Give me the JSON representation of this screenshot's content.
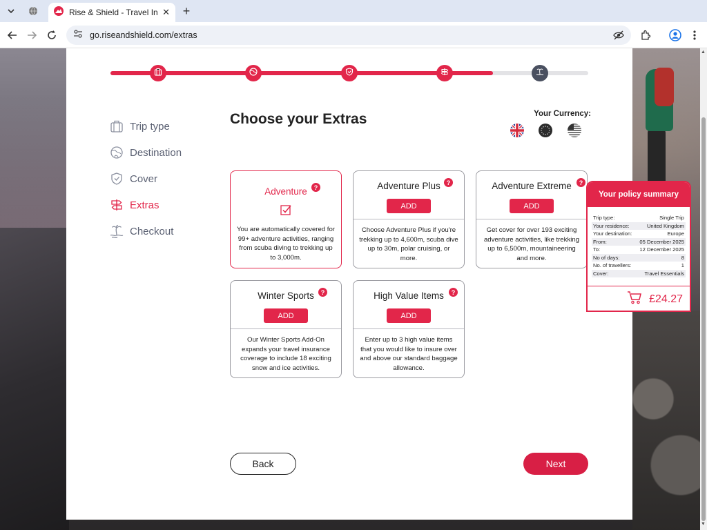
{
  "browser": {
    "tab_title": "Rise & Shield - Travel Insurance",
    "tab_close": "✕",
    "new_tab": "+",
    "url": "go.riseandshield.com/extras"
  },
  "nav": {
    "items": [
      {
        "label": "Trip type",
        "icon": "luggage-icon"
      },
      {
        "label": "Destination",
        "icon": "globe-icon"
      },
      {
        "label": "Cover",
        "icon": "shield-heart-icon"
      },
      {
        "label": "Extras",
        "icon": "signpost-icon"
      },
      {
        "label": "Checkout",
        "icon": "beach-icon"
      }
    ],
    "active": "Extras"
  },
  "progress": {
    "completed_steps": 4,
    "total_steps": 5,
    "fill_fraction": 0.8
  },
  "page": {
    "title": "Choose your Extras"
  },
  "currency": {
    "label": "Your Currency:",
    "options": [
      "GBP",
      "EUR",
      "USD"
    ],
    "selected": "GBP"
  },
  "extras": [
    {
      "title": "Adventure",
      "state": "included",
      "desc": "You are automatically covered for 99+ adventure activities, ranging from scuba diving to trekking up to 3,000m."
    },
    {
      "title": "Adventure Plus",
      "state": "available",
      "button": "ADD",
      "desc": "Choose Adventure Plus if you're trekking up to 4,600m, scuba dive up to 30m, polar cruising, or more."
    },
    {
      "title": "Adventure Extreme",
      "state": "available",
      "button": "ADD",
      "desc": "Get cover for over 193 exciting adventure activities, like trekking up to 6,500m, mountaineering and more."
    },
    {
      "title": "Winter Sports",
      "state": "available",
      "button": "ADD",
      "desc": "Our Winter Sports Add-On expands your travel insurance coverage to include 18 exciting snow and ice activities."
    },
    {
      "title": "High Value Items",
      "state": "available",
      "button": "ADD",
      "desc": "Enter up to 3 high value items that you would like to insure over and above our standard baggage allowance."
    }
  ],
  "help_glyph": "?",
  "buttons": {
    "back": "Back",
    "next": "Next"
  },
  "summary": {
    "title": "Your policy summary",
    "rows": [
      {
        "label": "Trip type:",
        "value": "Single Trip"
      },
      {
        "label": "Your residence:",
        "value": "United Kingdom"
      },
      {
        "label": "Your destination:",
        "value": "Europe"
      },
      {
        "label": "From:",
        "value": "05 December 2025"
      },
      {
        "label": "To:",
        "value": "12 December 2025"
      },
      {
        "label": "No of days:",
        "value": "8"
      },
      {
        "label": "No. of travellers:",
        "value": "1"
      },
      {
        "label": "Cover:",
        "value": "Travel Essentials"
      }
    ],
    "price": "£24.27"
  },
  "colors": {
    "brand": "#e2264a",
    "text": "#222222",
    "muted": "#5a6072"
  }
}
